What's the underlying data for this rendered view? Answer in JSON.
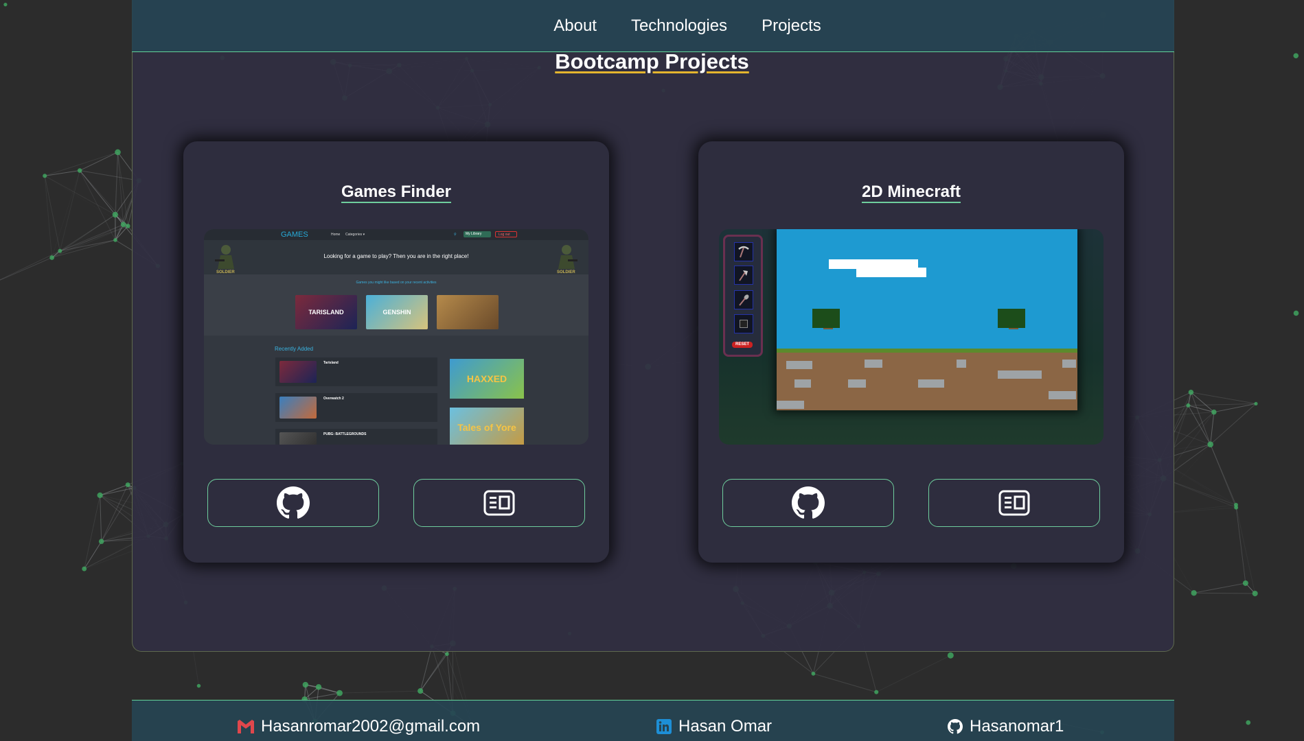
{
  "nav": {
    "about": "About",
    "technologies": "Technologies",
    "projects": "Projects"
  },
  "section_title": "Bootcamp Projects",
  "projects": [
    {
      "title": "Games Finder",
      "github_icon": "github-icon",
      "readme_icon": "readme-icon",
      "preview": {
        "brand": "GAMES",
        "nav_home": "Home",
        "nav_categories": "Categories ▾",
        "my_library": "My Library",
        "logout": "Log out",
        "hero_text": "Looking for a game to play? Then you are in the right place!",
        "subtitle": "Games you might like based on your recent activities",
        "logo_text": "SOLDIER",
        "thumbs": [
          "TARISLAND",
          "GENSHIN",
          ""
        ],
        "recently_added": "Recently Added",
        "recent_rows": [
          "Tarisland",
          "Overwatch 2",
          "PUBG: BATTLEGROUNDS"
        ],
        "big_tiles": [
          "HAXXED",
          "Tales of Yore"
        ]
      }
    },
    {
      "title": "2D Minecraft",
      "github_icon": "github-icon",
      "readme_icon": "readme-icon",
      "preview": {
        "tools": [
          "pickaxe-icon",
          "axe-icon",
          "shovel-icon",
          "block-slot-icon"
        ],
        "reset": "RESET"
      }
    }
  ],
  "footer": {
    "email": "Hasanromar2002@gmail.com",
    "linkedin": "Hasan Omar",
    "github": "Hasanomar1"
  },
  "colors": {
    "accent_green": "#6fcf9e",
    "title_underline": "#e4b52e",
    "panel_bg": "#302e42",
    "bar_bg": "#264452",
    "card_bg": "#2e2d3e",
    "page_bg": "#2c2c2c"
  }
}
